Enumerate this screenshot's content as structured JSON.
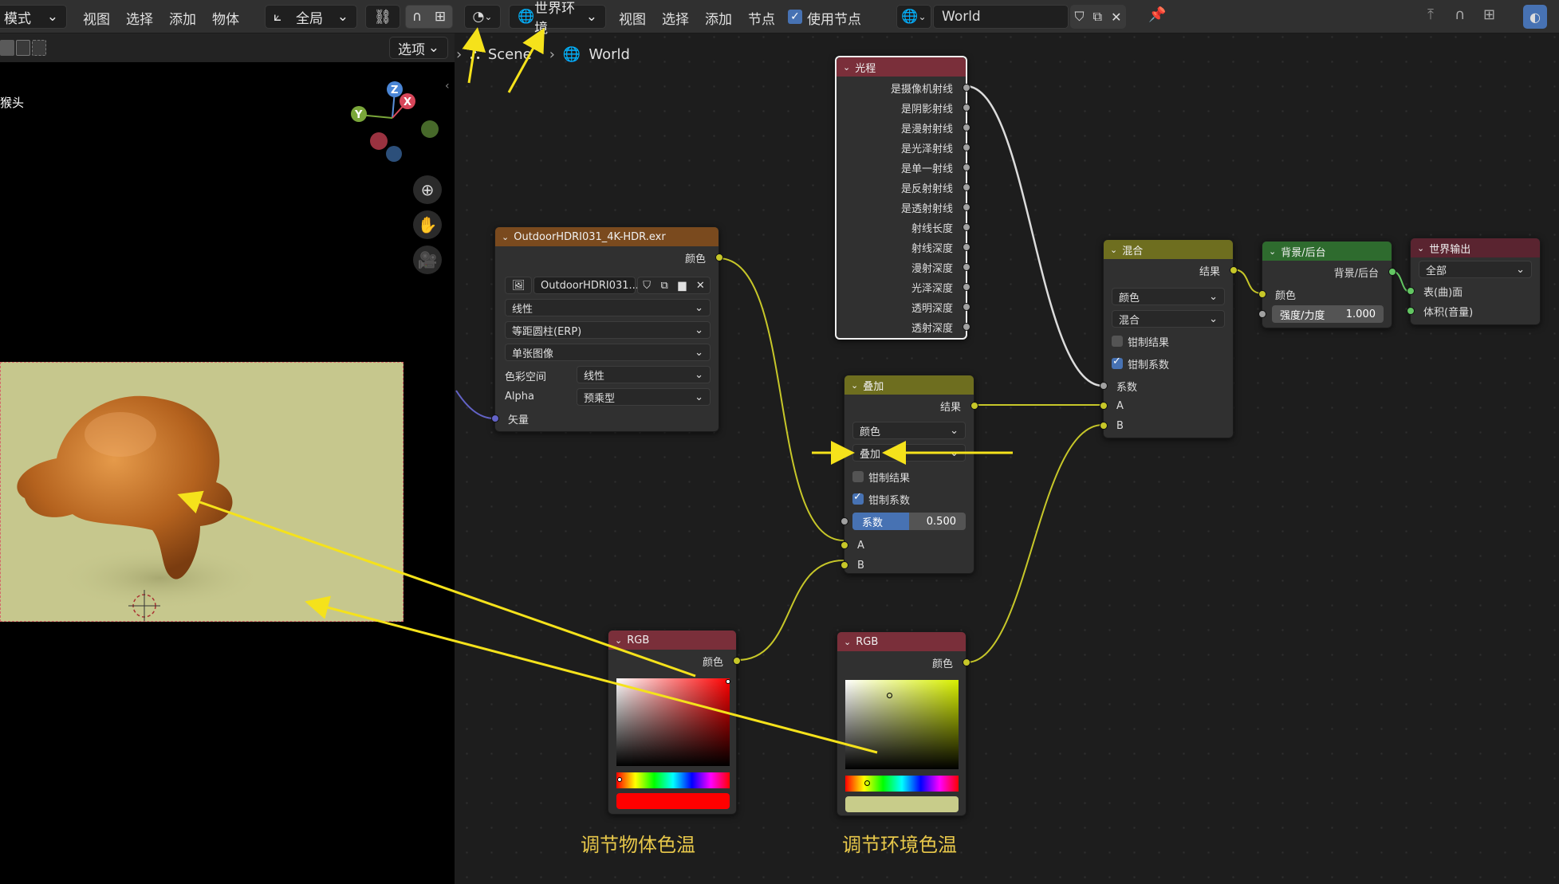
{
  "viewport": {
    "menu": [
      "模式",
      "视图",
      "选择",
      "添加",
      "物体"
    ],
    "transform_dd": "全局",
    "options_dd": "选项",
    "object_label": "猴头",
    "axes": {
      "z": "Z",
      "x": "X",
      "y": "Y"
    }
  },
  "editor_header": {
    "world_dd": "世界环境",
    "menu": [
      "视图",
      "选择",
      "添加",
      "节点"
    ],
    "use_nodes_label": "使用节点",
    "use_nodes": true,
    "world_name": "World"
  },
  "breadcrumb": {
    "scene": "Scene",
    "world": "World"
  },
  "nodes": {
    "light_path": {
      "title": "光程",
      "outputs": [
        "是摄像机射线",
        "是阴影射线",
        "是漫射射线",
        "是光泽射线",
        "是单一射线",
        "是反射射线",
        "是透射射线",
        "射线长度",
        "射线深度",
        "漫射深度",
        "光泽深度",
        "透明深度",
        "透射深度"
      ]
    },
    "image": {
      "title": "OutdoorHDRI031_4K-HDR.exr",
      "output": "颜色",
      "image_name": "OutdoorHDRI031...",
      "interpolation": "线性",
      "projection": "等距圆柱(ERP)",
      "source": "单张图像",
      "colorspace_label": "色彩空间",
      "colorspace": "线性",
      "alpha_label": "Alpha",
      "alpha": "预乘型",
      "input": "矢量"
    },
    "mix_add": {
      "title": "叠加",
      "output": "结果",
      "data_type": "颜色",
      "blend": "叠加",
      "clamp_result_label": "钳制结果",
      "clamp_result": false,
      "clamp_factor_label": "钳制系数",
      "clamp_factor": true,
      "factor_label": "系数",
      "factor": "0.500",
      "factor_value": 0.5,
      "input_a": "A",
      "input_b": "B"
    },
    "mix": {
      "title": "混合",
      "output": "结果",
      "data_type": "颜色",
      "blend": "混合",
      "clamp_result_label": "钳制结果",
      "clamp_result": false,
      "clamp_factor_label": "钳制系数",
      "clamp_factor": true,
      "factor_label": "系数",
      "input_a": "A",
      "input_b": "B"
    },
    "background": {
      "title": "背景/后台",
      "output": "背景/后台",
      "color_label": "颜色",
      "strength_label": "强度/力度",
      "strength": "1.000"
    },
    "world_output": {
      "title": "世界输出",
      "target": "全部",
      "surface": "表(曲)面",
      "volume": "体积(音量)"
    },
    "rgb_left": {
      "title": "RGB",
      "output": "颜色",
      "color": "#ff0000"
    },
    "rgb_right": {
      "title": "RGB",
      "output": "颜色",
      "color": "#c8cc8a"
    }
  },
  "captions": {
    "object": "调节物体色温",
    "environment": "调节环境色温"
  },
  "colors": {
    "node_header_image": "#7a4a1e",
    "node_header_light": "#7a2f3a",
    "node_header_mix": "#6e6e1f",
    "node_header_bg": "#2e6b2e",
    "node_header_output": "#5a2430",
    "node_header_rgb": "#7a2f3a",
    "annotation": "#f5e21b",
    "render_bg": "#c6c78d"
  }
}
